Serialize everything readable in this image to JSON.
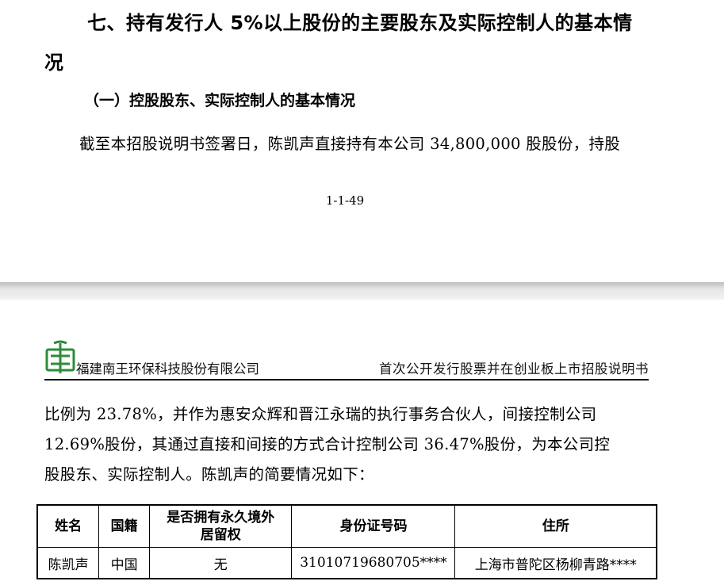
{
  "page1": {
    "heading_line1": "七、持有发行人 5%以上股份的主要股东及实际控制人的基本情",
    "heading_line2": "况",
    "subheading": "（一）控股股东、实际控制人的基本情况",
    "paragraph": "截至本招股说明书签署日，陈凯声直接持有本公司 34,800,000 股股份，持股",
    "page_number": "1-1-49"
  },
  "page2": {
    "header": {
      "company_name": "福建南王环保科技股份有限公司",
      "document_title": "首次公开发行股票并在创业板上市招股说明书",
      "logo_color": "#2e8b3a"
    },
    "paragraph_lines": [
      "比例为 23.78%，并作为惠安众辉和晋江永瑞的执行事务合伙人，间接控制公司",
      "12.69%股份，其通过直接和间接的方式合计控制公司 36.47%股份，为本公司控",
      "股股东、实际控制人。陈凯声的简要情况如下："
    ],
    "table": {
      "headers": [
        "姓名",
        "国籍",
        "是否拥有永久境外居留权",
        "身份证号码",
        "住所"
      ],
      "rows": [
        [
          "陈凯声",
          "中国",
          "无",
          "31010719680705****",
          "上海市普陀区杨柳青路****"
        ]
      ]
    }
  }
}
